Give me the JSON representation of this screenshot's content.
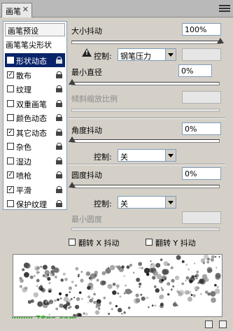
{
  "panel": {
    "tab_title": "画笔",
    "close_glyph": "✕"
  },
  "sidebar": {
    "preset_button": "画笔预设",
    "tip_shape_label": "画笔笔尖形状",
    "items": [
      {
        "label": "形状动态",
        "checked": true,
        "selected": true
      },
      {
        "label": "散布",
        "checked": true
      },
      {
        "label": "纹理",
        "checked": false
      },
      {
        "label": "双重画笔",
        "checked": false
      },
      {
        "label": "颜色动态",
        "checked": false
      },
      {
        "label": "其它动态",
        "checked": true
      },
      {
        "label": "杂色",
        "checked": false
      },
      {
        "label": "湿边",
        "checked": false
      },
      {
        "label": "喷枪",
        "checked": true
      },
      {
        "label": "平滑",
        "checked": true
      },
      {
        "label": "保护纹理",
        "checked": false
      }
    ]
  },
  "size_jitter": {
    "label": "大小抖动",
    "value": "100%",
    "level": 1.0
  },
  "size_control": {
    "label": "控制:",
    "value": "钢笔压力"
  },
  "min_diameter": {
    "label": "最小直径",
    "value": "0%",
    "level": 0.0
  },
  "tilt_scale": {
    "label": "倾斜缩放比例"
  },
  "angle_jitter": {
    "label": "角度抖动",
    "value": "0%",
    "level": 0.0
  },
  "angle_control": {
    "label": "控制:",
    "value": "关"
  },
  "roundness_jitter": {
    "label": "圆度抖动",
    "value": "0%",
    "level": 0.0
  },
  "roundness_control": {
    "label": "控制:",
    "value": "关"
  },
  "min_roundness": {
    "label": "最小圆度"
  },
  "flip_x": {
    "label": "翻转 X 抖动",
    "checked": false
  },
  "flip_y": {
    "label": "翻转 Y 抖动",
    "checked": false
  },
  "watermark": "www.78ps.com"
}
